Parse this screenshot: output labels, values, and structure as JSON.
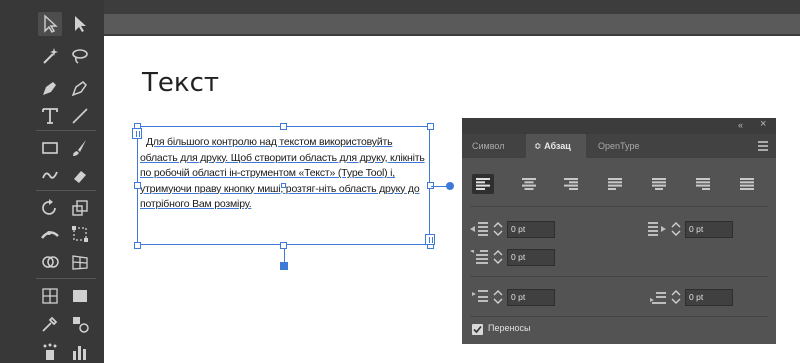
{
  "tools": {
    "items": [
      "selection-tool",
      "direct-selection-tool",
      "magic-wand-tool",
      "lasso-tool",
      "pen-tool",
      "curvature-tool",
      "type-tool",
      "line-segment-tool",
      "rectangle-tool",
      "paintbrush-tool",
      "shaper-tool",
      "eraser-tool",
      "rotate-tool",
      "scale-tool",
      "width-tool",
      "free-transform-tool",
      "shape-builder-tool",
      "perspective-grid-tool",
      "mesh-tool",
      "gradient-tool",
      "eyedropper-tool",
      "blend-tool",
      "symbol-sprayer-tool",
      "column-graph-tool"
    ]
  },
  "artboard": {
    "heading": "Текст",
    "text_frame": {
      "content": "Для більшого контролю над текстом використовуйть область для друку. Щоб створити область для друку, клікніть по робочій області ін-струментом «Текст» (Type Tool) і, утримуючи праву кнопку миші, розтяг-ніть область друку до потрібного Вам розміру."
    }
  },
  "paragraph_panel": {
    "collapse_label": "«",
    "close_label": "×",
    "tabs": [
      {
        "label": "Символ",
        "active": false
      },
      {
        "label": "Абзац",
        "active": true
      },
      {
        "label": "OpenType",
        "active": false
      }
    ],
    "active_tab_prefix": "≎",
    "alignment_buttons": [
      "align-left",
      "align-center",
      "align-right",
      "justify-last-left",
      "justify-last-center",
      "justify-last-right",
      "justify-all"
    ],
    "left_indent": "0 pt",
    "right_indent": "0 pt",
    "first_line_indent": "0 pt",
    "space_before": "0 pt",
    "space_after": "0 pt",
    "hyphenate_label": "Переносы",
    "hyphenate_checked": true
  },
  "colors": {
    "selection_blue": "#3f7ad8",
    "panel_bg": "#535353",
    "toolbar_bg": "#383838"
  }
}
